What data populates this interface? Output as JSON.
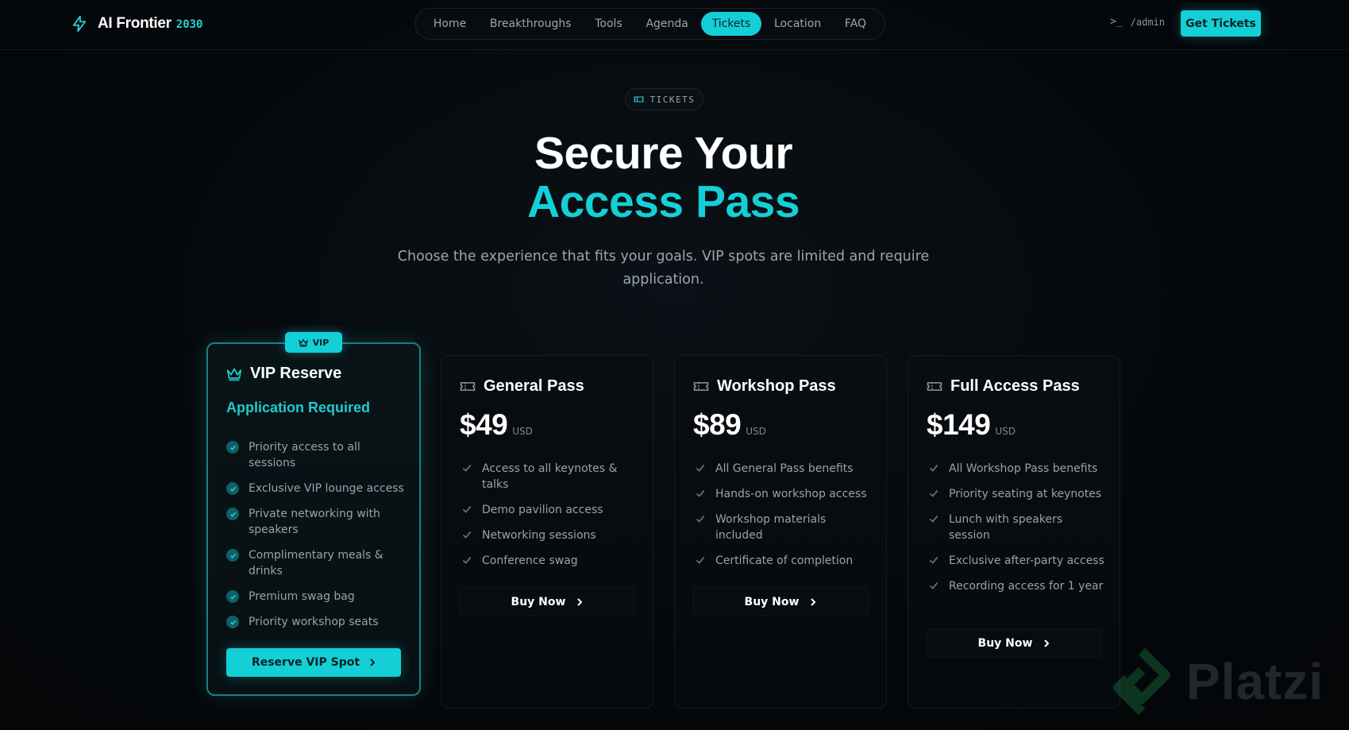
{
  "header": {
    "brand_name": "AI Frontier",
    "brand_year": "2030",
    "nav": [
      "Home",
      "Breakthroughs",
      "Tools",
      "Agenda",
      "Tickets",
      "Location",
      "FAQ"
    ],
    "active_nav": "Tickets",
    "admin_prompt": ">_",
    "admin_label": "/admin",
    "cta_label": "Get Tickets"
  },
  "hero": {
    "pill_label": "TICKETS",
    "title_line1": "Secure Your",
    "title_line2": "Access Pass",
    "subtitle": "Choose the experience that fits your goals. VIP spots are limited and require application."
  },
  "vip": {
    "badge": "VIP",
    "title": "VIP Reserve",
    "subtitle": "Application Required",
    "features": [
      "Priority access to all sessions",
      "Exclusive VIP lounge access",
      "Private networking with speakers",
      "Complimentary meals & drinks",
      "Premium swag bag",
      "Priority workshop seats"
    ],
    "button": "Reserve VIP Spot"
  },
  "plans": [
    {
      "title": "General Pass",
      "price": "$49",
      "currency": "USD",
      "features": [
        "Access to all keynotes & talks",
        "Demo pavilion access",
        "Networking sessions",
        "Conference swag"
      ],
      "button": "Buy Now"
    },
    {
      "title": "Workshop Pass",
      "price": "$89",
      "currency": "USD",
      "features": [
        "All General Pass benefits",
        "Hands-on workshop access",
        "Workshop materials included",
        "Certificate of completion"
      ],
      "button": "Buy Now"
    },
    {
      "title": "Full Access Pass",
      "price": "$149",
      "currency": "USD",
      "features": [
        "All Workshop Pass benefits",
        "Priority seating at keynotes",
        "Lunch with speakers session",
        "Exclusive after-party access",
        "Recording access for 1 year"
      ],
      "button": "Buy Now"
    }
  ],
  "watermark": "Platzi",
  "colors": {
    "accent": "#14d0d6",
    "background": "#05080b",
    "text_muted": "#97a3ad"
  }
}
